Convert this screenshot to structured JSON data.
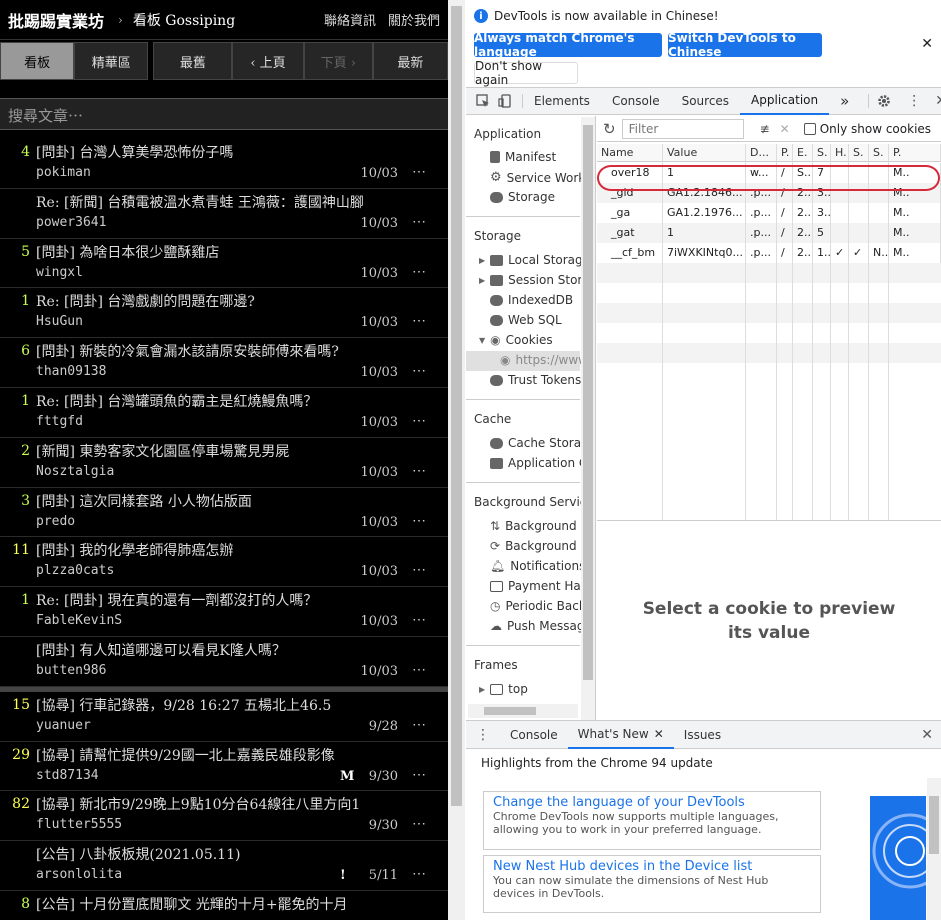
{
  "ptt": {
    "logo": "批踢踢實業坊",
    "separator": "›",
    "board": "看板 Gossiping",
    "contact": "聯絡資訊",
    "about": "關於我們",
    "buttons": [
      "看板",
      "精華區",
      "最舊",
      "‹ 上頁",
      "下頁 ›",
      "最新"
    ],
    "search_placeholder": "搜尋文章⋯",
    "posts": [
      {
        "count": "4",
        "title": "[問卦] 台灣人算美學恐怖份子嗎",
        "author": "pokiman",
        "date": "10/03",
        "mark": ""
      },
      {
        "count": "",
        "title": "Re: [新聞] 台積電被溫水煮青蛙 王鴻薇：護國神山腳",
        "author": "power3641",
        "date": "10/03",
        "mark": ""
      },
      {
        "count": "5",
        "title": "[問卦] 為啥日本很少鹽酥雞店",
        "author": "wingxl",
        "date": "10/03",
        "mark": ""
      },
      {
        "count": "1",
        "title": "Re: [問卦] 台灣戲劇的問題在哪邊?",
        "author": "HsuGun",
        "date": "10/03",
        "mark": ""
      },
      {
        "count": "6",
        "title": "[問卦] 新裝的冷氣會漏水該請原安裝師傅來看嗎?",
        "author": "than09138",
        "date": "10/03",
        "mark": ""
      },
      {
        "count": "1",
        "title": "Re: [問卦] 台灣罐頭魚的霸主是紅燒鰻魚嗎？",
        "author": "fttgfd",
        "date": "10/03",
        "mark": ""
      },
      {
        "count": "2",
        "title": "[新聞] 東勢客家文化園區停車場驚見男屍",
        "author": "Nosztalgia",
        "date": "10/03",
        "mark": ""
      },
      {
        "count": "3",
        "title": "[問卦] 這次同樣套路 小人物佔版面",
        "author": "predo",
        "date": "10/03",
        "mark": ""
      },
      {
        "count": "11",
        "title": "[問卦] 我的化學老師得肺癌怎辦",
        "author": "plzza0cats",
        "date": "10/03",
        "mark": ""
      },
      {
        "count": "1",
        "title": "Re: [問卦] 現在真的還有一劑都沒打的人嗎？",
        "author": "FableKevinS",
        "date": "10/03",
        "mark": ""
      },
      {
        "count": "",
        "title": "[問卦] 有人知道哪邊可以看見K隆人嗎？",
        "author": "butten986",
        "date": "10/03",
        "mark": ""
      }
    ],
    "pinned": [
      {
        "count": "15",
        "title": "[協尋] 行車記錄器，9/28 16:27 五楊北上46.5",
        "author": "yuanuer",
        "date": "9/28",
        "mark": ""
      },
      {
        "count": "29",
        "title": "[協尋] 請幫忙提供9/29國一北上嘉義民雄段影像",
        "author": "std87134",
        "date": "9/30",
        "mark": "M"
      },
      {
        "count": "82",
        "title": "[協尋] 新北市9/29晚上9點10分台64線往八里方向1",
        "author": "flutter5555",
        "date": "9/30",
        "mark": ""
      },
      {
        "count": "",
        "title": "[公告] 八卦板板規(2021.05.11)",
        "author": "arsonlolita",
        "date": "5/11",
        "mark": "!"
      },
      {
        "count": "8",
        "title": "[公告] 十月份置底閒聊文 光輝的十月+罷免的十月",
        "author": "",
        "date": "",
        "mark": ""
      }
    ],
    "dots": "⋯"
  },
  "devtools": {
    "info_message": "DevTools is now available in Chinese!",
    "btn_match": "Always match Chrome's language",
    "btn_switch": "Switch DevTools to Chinese",
    "btn_dont_show": "Don't show again",
    "tabs": [
      "Elements",
      "Console",
      "Sources",
      "Application"
    ],
    "active_tab": "Application",
    "more": "»",
    "sidebar": {
      "application_header": "Application",
      "application_items": [
        "Manifest",
        "Service Worke",
        "Storage"
      ],
      "storage_header": "Storage",
      "storage_items": [
        "Local Storage",
        "Session Stora",
        "IndexedDB",
        "Web SQL",
        "Cookies",
        "https://www",
        "Trust Tokens"
      ],
      "cache_header": "Cache",
      "cache_items": [
        "Cache Storag",
        "Application C"
      ],
      "bg_header": "Background Service",
      "bg_items": [
        "Background F",
        "Background S",
        "Notifications",
        "Payment Han",
        "Periodic Back",
        "Push Messag"
      ],
      "frames_header": "Frames",
      "frames_items": [
        "top"
      ]
    },
    "filter_placeholder": "Filter",
    "only_show_label": "Only show cookies",
    "columns": [
      "Name",
      "Value",
      "D...",
      "P.",
      "E.",
      "S.",
      "H.",
      "S.",
      "S.",
      "P."
    ],
    "cookies": [
      {
        "name": "over18",
        "value": "1",
        "domain": "w...",
        "path": "/",
        "expires": "S...",
        "size": "7",
        "http": "",
        "secure": "",
        "samesite": "",
        "priority": "M.."
      },
      {
        "name": "_gid",
        "value": "GA1.2.1846...",
        "domain": ".p...",
        "path": "/",
        "expires": "2...",
        "size": "3...",
        "http": "",
        "secure": "",
        "samesite": "",
        "priority": "M.."
      },
      {
        "name": "_ga",
        "value": "GA1.2.1976...",
        "domain": ".p...",
        "path": "/",
        "expires": "2...",
        "size": "3...",
        "http": "",
        "secure": "",
        "samesite": "",
        "priority": "M.."
      },
      {
        "name": "_gat",
        "value": "1",
        "domain": ".p...",
        "path": "/",
        "expires": "2...",
        "size": "5",
        "http": "",
        "secure": "",
        "samesite": "",
        "priority": "M.."
      },
      {
        "name": "__cf_bm",
        "value": "7iWXKINtq0...",
        "domain": ".p...",
        "path": "/",
        "expires": "2...",
        "size": "1...",
        "http": "✓",
        "secure": "✓",
        "samesite": "N...",
        "priority": "M.."
      }
    ],
    "preview_text": "Select a cookie to preview its value",
    "drawer_tabs": [
      "Console",
      "What's New",
      "Issues"
    ],
    "drawer_active": "What's New",
    "highlights": "Highlights from the Chrome 94 update",
    "cards": [
      {
        "title": "Change the language of your DevTools",
        "body": "Chrome DevTools now supports multiple languages, allowing you to work in your preferred language."
      },
      {
        "title": "New Nest Hub devices in the Device list",
        "body": "You can now simulate the dimensions of Nest Hub devices in DevTools."
      }
    ],
    "accent": "#1a73e8",
    "highlight_oval": "#d62a3b"
  }
}
